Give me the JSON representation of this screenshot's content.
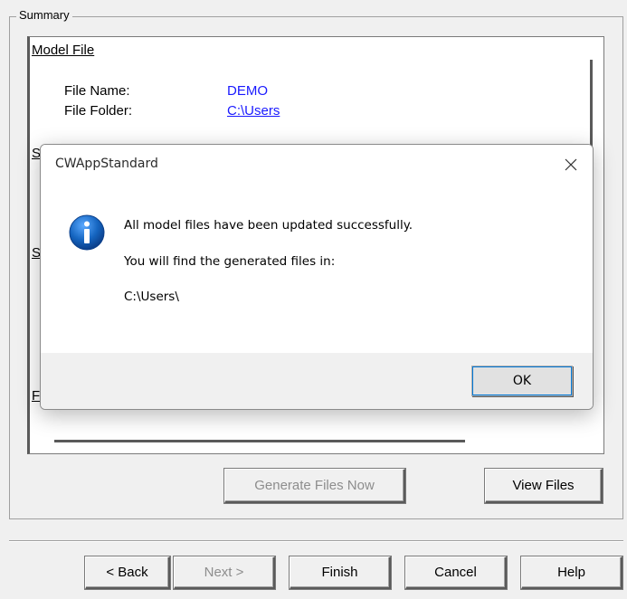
{
  "groupbox": {
    "title": "Summary"
  },
  "panel": {
    "section_title": "Model File",
    "file_name_label": "File Name:",
    "file_name_value": "DEMO",
    "file_folder_label": "File Folder:",
    "file_folder_value": "C:\\Users",
    "clipped_glyph_1": "S",
    "clipped_glyph_2": "S",
    "clipped_glyph_3": "F"
  },
  "buttons": {
    "generate": "Generate Files Now",
    "view_files": "View Files",
    "back": "< Back",
    "next": "Next >",
    "finish": "Finish",
    "cancel": "Cancel",
    "help": "Help"
  },
  "dialog": {
    "title": "CWAppStandard",
    "icon": "info-icon",
    "line1": "All model files have been updated successfully.",
    "line2": "You will find the generated files in:",
    "path": "C:\\Users\\",
    "ok": "OK"
  },
  "colors": {
    "link": "#1a1aff",
    "info_icon": "#1565c0"
  }
}
